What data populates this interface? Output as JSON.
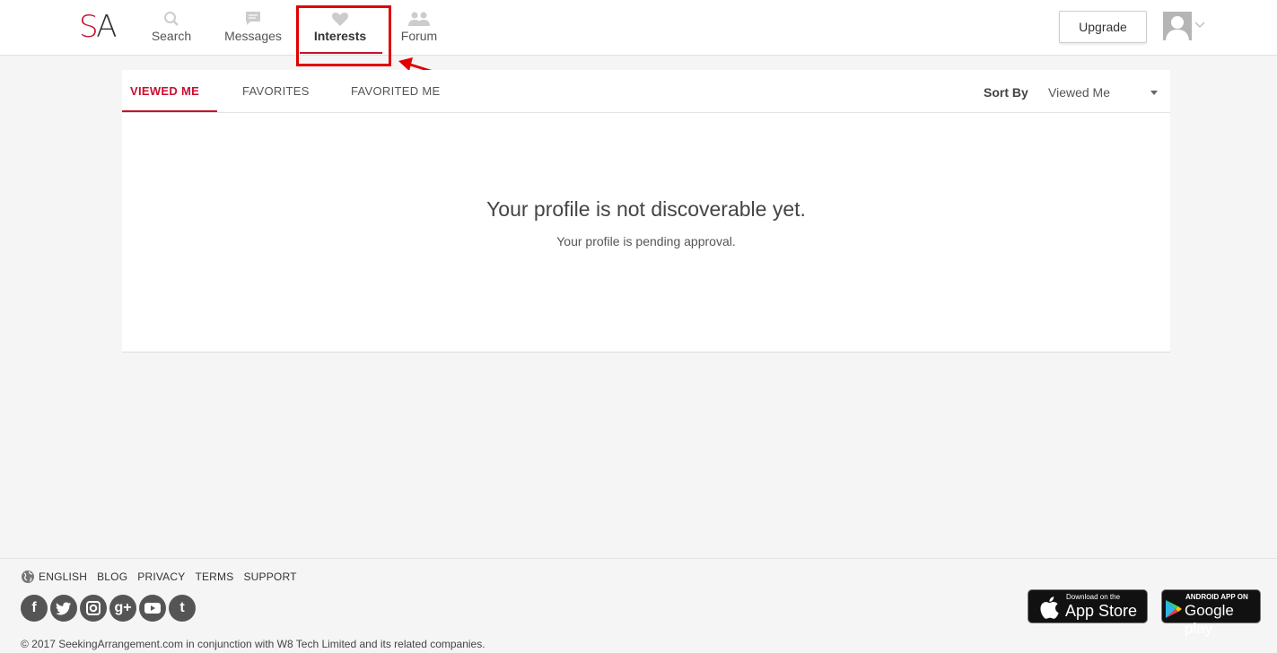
{
  "header": {
    "logo": {
      "s": "S",
      "a": "A"
    },
    "nav": [
      {
        "label": "Search",
        "icon": "search-icon"
      },
      {
        "label": "Messages",
        "icon": "message-icon"
      },
      {
        "label": "Interests",
        "icon": "heart-icon"
      },
      {
        "label": "Forum",
        "icon": "people-icon"
      }
    ],
    "active_nav": "Interests",
    "upgrade_label": "Upgrade"
  },
  "tabs": [
    {
      "label": "VIEWED ME",
      "active": true
    },
    {
      "label": "FAVORITES",
      "active": false
    },
    {
      "label": "FAVORITED ME",
      "active": false
    }
  ],
  "sort": {
    "label": "Sort By",
    "value": "Viewed Me"
  },
  "empty_state": {
    "title": "Your profile is not discoverable yet.",
    "subtitle": "Your profile is pending approval."
  },
  "footer": {
    "links": [
      "ENGLISH",
      "BLOG",
      "PRIVACY",
      "TERMS",
      "SUPPORT"
    ],
    "social": [
      {
        "name": "facebook-icon",
        "glyph": "f"
      },
      {
        "name": "twitter-icon",
        "glyph": "t"
      },
      {
        "name": "instagram-icon",
        "glyph": "◎"
      },
      {
        "name": "google-plus-icon",
        "glyph": "g+"
      },
      {
        "name": "youtube-icon",
        "glyph": "▶"
      },
      {
        "name": "tumblr-icon",
        "glyph": "t"
      }
    ],
    "copyright": "© 2017 SeekingArrangement.com in conjunction with W8 Tech Limited and its related companies.",
    "app_store": {
      "small": "Download on the",
      "big": "App Store"
    },
    "google_play": {
      "small": "ANDROID APP ON",
      "big": "Google play"
    }
  },
  "colors": {
    "accent": "#c8102e",
    "annotation": "#e00000"
  }
}
